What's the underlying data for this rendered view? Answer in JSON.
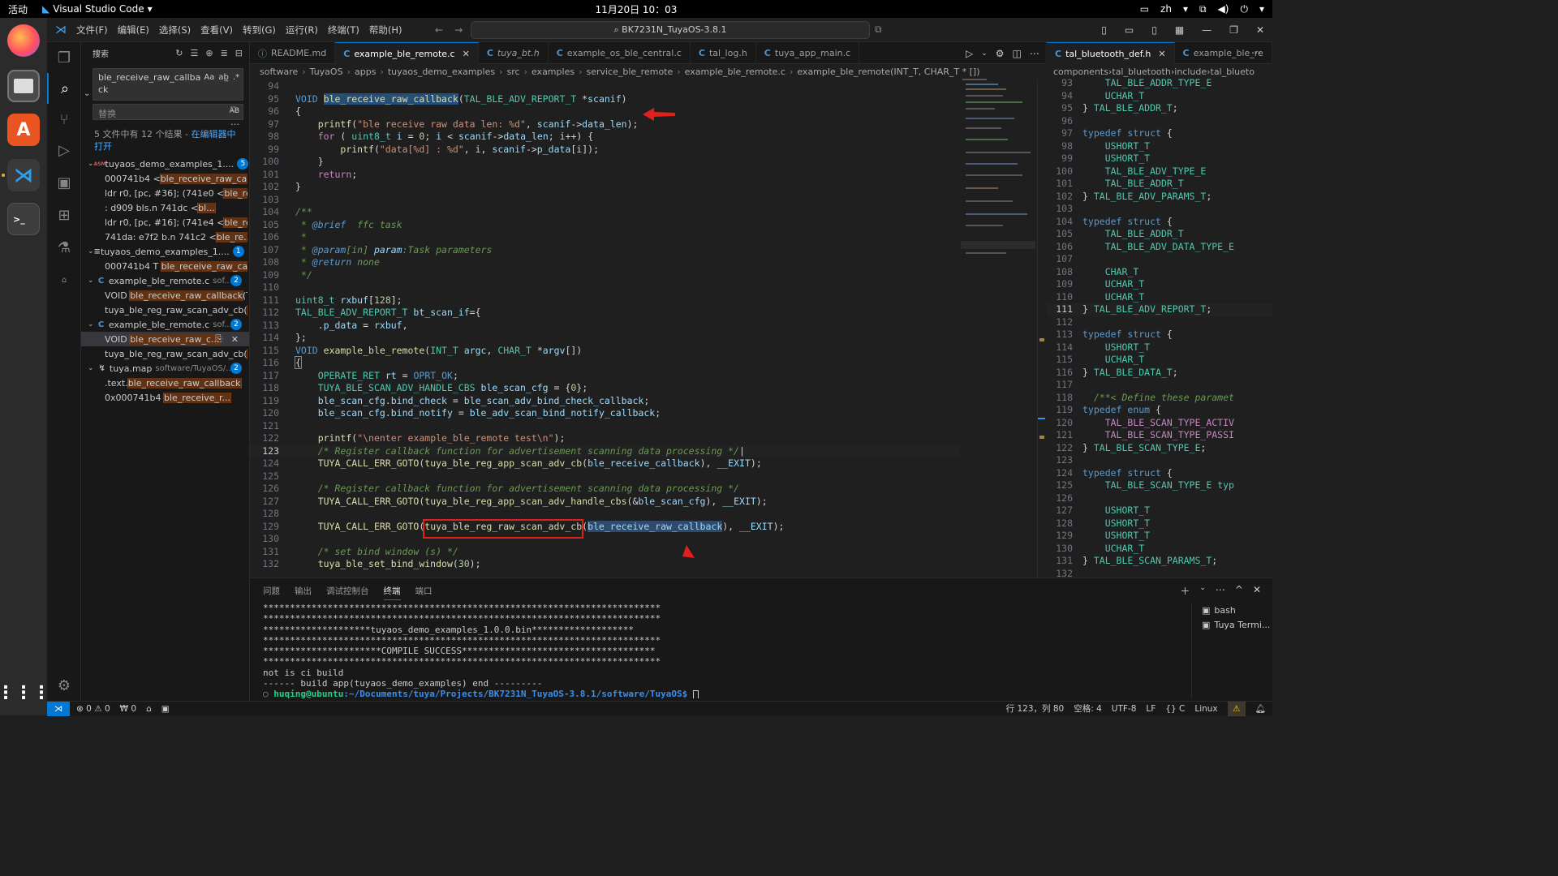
{
  "topbar": {
    "activities": "活动",
    "app_name": "Visual Studio Code",
    "clock": "11月20日  10：03",
    "lang": "zh"
  },
  "title": {
    "menu": [
      "文件(F)",
      "编辑(E)",
      "选择(S)",
      "查看(V)",
      "转到(G)",
      "运行(R)",
      "终端(T)",
      "帮助(H)"
    ],
    "command_center": "BK7231N_TuyaOS-3.8.1"
  },
  "sidebar": {
    "header": "搜索",
    "search_value": "ble_receive_raw_callback",
    "replace_placeholder": "替换",
    "replace_toggle": "AB",
    "summary_prefix": "5 文件中有 12 个结果 - ",
    "summary_link": "在编辑器中打开",
    "groups": [
      {
        "name": "tuyaos_demo_examples_1....",
        "path": "",
        "icon": "ASM",
        "count": "5",
        "matches": [
          {
            "before": "000741b4 <",
            "hit": "ble_receive_raw_callb...",
            "after": ""
          },
          {
            "before": "ldr  r0, [pc, #36]; (741e0 <",
            "hit": "ble_rece...",
            "after": ""
          },
          {
            "before": ":     d909          bls.n      741dc <",
            "hit": "bl...",
            "after": ""
          },
          {
            "before": "ldr  r0, [pc, #16]; (741e4 <",
            "hit": "ble_rece...",
            "after": ""
          },
          {
            "before": "741da:  e7f2        b.n 741c2 <",
            "hit": "ble_re...",
            "after": ""
          }
        ]
      },
      {
        "name": "tuyaos_demo_examples_1....",
        "path": "",
        "icon": "≡",
        "count": "1",
        "matches": [
          {
            "before": "000741b4 T ",
            "hit": "ble_receive_raw_callb...",
            "after": ""
          }
        ]
      },
      {
        "name": "example_ble_remote.c",
        "path": "sof...",
        "icon": "C",
        "count": "2",
        "matches": [
          {
            "before": "VOID ",
            "hit": "ble_receive_raw_callback",
            "after": "(TA..."
          },
          {
            "before": "tuya_ble_reg_raw_scan_adv_cb(",
            "hit": "bl...",
            "after": ""
          }
        ]
      },
      {
        "name": "example_ble_remote.c",
        "path": "sof...",
        "icon": "C",
        "count": "2",
        "matches": [
          {
            "before": "VOID ",
            "hit": "ble_receive_raw_c...",
            "after": "",
            "selected": true
          },
          {
            "before": "tuya_ble_reg_raw_scan_adv_cb(",
            "hit": "bl...",
            "after": ""
          }
        ]
      },
      {
        "name": "tuya.map",
        "path": "software/TuyaOS/...",
        "icon": "↯",
        "count": "2",
        "matches": [
          {
            "before": ".text.",
            "hit": "ble_receive_raw_callback",
            "after": ""
          },
          {
            "before": "0x000741b4              ",
            "hit": "ble_receive_r...",
            "after": ""
          }
        ]
      }
    ]
  },
  "editor": {
    "tabs": [
      {
        "label": "README.md",
        "icon": "ⓘ",
        "active": false,
        "italic": false
      },
      {
        "label": "example_ble_remote.c",
        "icon": "C",
        "active": true,
        "italic": false
      },
      {
        "label": "tuya_bt.h",
        "icon": "C",
        "active": false,
        "italic": true
      },
      {
        "label": "example_os_ble_central.c",
        "icon": "C",
        "active": false,
        "italic": false
      },
      {
        "label": "tal_log.h",
        "icon": "C",
        "active": false,
        "italic": false
      },
      {
        "label": "tuya_app_main.c",
        "icon": "C",
        "active": false,
        "italic": false
      }
    ],
    "breadcrumb": [
      "software",
      "TuyaOS",
      "apps",
      "tuyaos_demo_examples",
      "src",
      "examples",
      "service_ble_remote",
      "example_ble_remote.c",
      "example_ble_remote(INT_T, CHAR_T * [])"
    ],
    "current_line": "123",
    "lines": [
      {
        "n": "94",
        "html": ""
      },
      {
        "n": "95",
        "html": "<span class='k'>VOID</span> <span class='f hl'>ble_receive_raw_callback</span><span class='p'>(</span><span class='t'>TAL_BLE_ADV_REPORT_T</span> <span class='p'>*</span><span class='v'>scanif</span><span class='p'>)</span>"
      },
      {
        "n": "96",
        "html": "<span class='p'>{</span>"
      },
      {
        "n": "97",
        "html": "    <span class='f'>printf</span><span class='p'>(</span><span class='s'>\"ble receive raw data len: %d\"</span><span class='p'>, </span><span class='v'>scanif</span><span class='p'>-&gt;</span><span class='v'>data_len</span><span class='p'>);</span>"
      },
      {
        "n": "98",
        "html": "    <span class='m'>for</span> <span class='p'>( </span><span class='t'>uint8_t</span> <span class='v'>i</span> <span class='p'>= </span><span class='n'>0</span><span class='p'>; </span><span class='v'>i</span> <span class='p'>&lt; </span><span class='v'>scanif</span><span class='p'>-&gt;</span><span class='v'>data_len</span><span class='p'>; </span><span class='v'>i</span><span class='p'>++) {</span>"
      },
      {
        "n": "99",
        "html": "        <span class='f'>printf</span><span class='p'>(</span><span class='s'>\"data[%d] : %d\"</span><span class='p'>, </span><span class='v'>i</span><span class='p'>, </span><span class='v'>scanif</span><span class='p'>-&gt;</span><span class='v'>p_data</span><span class='p'>[</span><span class='v'>i</span><span class='p'>]);</span>"
      },
      {
        "n": "100",
        "html": "    <span class='p'>}</span>"
      },
      {
        "n": "101",
        "html": "    <span class='m'>return</span><span class='p'>;</span>"
      },
      {
        "n": "102",
        "html": "<span class='p'>}</span>"
      },
      {
        "n": "103",
        "html": ""
      },
      {
        "n": "104",
        "html": "<span class='cm'>/**</span>"
      },
      {
        "n": "105",
        "html": "<span class='cm'> * </span><span class='k' style='font-style:italic'>@brief</span><span class='cm'>  ffc task</span>"
      },
      {
        "n": "106",
        "html": "<span class='cm'> *</span>"
      },
      {
        "n": "107",
        "html": "<span class='cm'> * </span><span class='k' style='font-style:italic'>@param</span><span class='cm'>[in] </span><span class='v' style='font-style:italic'>param</span><span class='cm'>:Task parameters</span>"
      },
      {
        "n": "108",
        "html": "<span class='cm'> * </span><span class='k' style='font-style:italic'>@return</span><span class='cm'> none</span>"
      },
      {
        "n": "109",
        "html": "<span class='cm'> */</span>"
      },
      {
        "n": "110",
        "html": ""
      },
      {
        "n": "111",
        "html": "<span class='t'>uint8_t</span> <span class='v'>rxbuf</span><span class='p'>[</span><span class='n'>128</span><span class='p'>];</span>"
      },
      {
        "n": "112",
        "html": "<span class='t'>TAL_BLE_ADV_REPORT_T</span> <span class='v'>bt_scan_if</span><span class='p'>={</span>"
      },
      {
        "n": "113",
        "html": "    <span class='p'>.</span><span class='v'>p_data</span> <span class='p'>= </span><span class='v'>rxbuf</span><span class='p'>,</span>"
      },
      {
        "n": "114",
        "html": "<span class='p'>};</span>"
      },
      {
        "n": "115",
        "html": "<span class='k'>VOID</span> <span class='f'>example_ble_remote</span><span class='p'>(</span><span class='t'>INT_T</span> <span class='v'>argc</span><span class='p'>, </span><span class='t'>CHAR_T</span> <span class='p'>*</span><span class='v'>argv</span><span class='p'>[])</span>"
      },
      {
        "n": "116",
        "html": "<span class='p' style='outline:1px solid #888'>{</span>"
      },
      {
        "n": "117",
        "html": "    <span class='t'>OPERATE_RET</span> <span class='v'>rt</span> <span class='p'>= </span><span class='k'>OPRT_OK</span><span class='p'>;</span>"
      },
      {
        "n": "118",
        "html": "    <span class='t'>TUYA_BLE_SCAN_ADV_HANDLE_CBS</span> <span class='v'>ble_scan_cfg</span> <span class='p'>= {</span><span class='n'>0</span><span class='p'>};</span>"
      },
      {
        "n": "119",
        "html": "    <span class='v'>ble_scan_cfg</span><span class='p'>.</span><span class='v'>bind_check</span> <span class='p'>= </span><span class='v'>ble_scan_adv_bind_check_callback</span><span class='p'>;</span>"
      },
      {
        "n": "120",
        "html": "    <span class='v'>ble_scan_cfg</span><span class='p'>.</span><span class='v'>bind_notify</span> <span class='p'>= </span><span class='v'>ble_adv_scan_bind_notify_callback</span><span class='p'>;</span>"
      },
      {
        "n": "121",
        "html": ""
      },
      {
        "n": "122",
        "html": "    <span class='f'>printf</span><span class='p'>(</span><span class='s'>\"\\nenter example_ble_remote test\\n\"</span><span class='p'>);</span>"
      },
      {
        "n": "123",
        "html": "    <span class='cm'>/* Register callback function for advertisement scanning data processing */</span><span class='p'>|</span>"
      },
      {
        "n": "124",
        "html": "    <span class='f'>TUYA_CALL_ERR_GOTO</span><span class='p'>(</span><span class='f'>tuya_ble_reg_app_scan_adv_cb</span><span class='p'>(</span><span class='v'>ble_receive_callback</span><span class='p'>), </span><span class='v'>__EXIT</span><span class='p'>);</span>"
      },
      {
        "n": "125",
        "html": ""
      },
      {
        "n": "126",
        "html": "    <span class='cm'>/* Register callback function for advertisement scanning data processing */</span>"
      },
      {
        "n": "127",
        "html": "    <span class='f'>TUYA_CALL_ERR_GOTO</span><span class='p'>(</span><span class='f'>tuya_ble_reg_app_scan_adv_handle_cbs</span><span class='p'>(&amp;</span><span class='v'>ble_scan_cfg</span><span class='p'>), </span><span class='v'>__EXIT</span><span class='p'>);</span>"
      },
      {
        "n": "128",
        "html": ""
      },
      {
        "n": "129",
        "html": "    <span class='f'>TUYA_CALL_ERR_GOTO</span><span class='p'>(</span><span class='f'>tuya_ble_reg_raw_scan_adv_cb</span><span class='p'>(</span><span class='v hl2'>ble_receive_raw_callback</span><span class='p'>), </span><span class='v'>__EXIT</span><span class='p'>);</span>"
      },
      {
        "n": "130",
        "html": ""
      },
      {
        "n": "131",
        "html": "    <span class='cm'>/* set bind window (s) */</span>"
      },
      {
        "n": "132",
        "html": "    <span class='f'>tuya_ble_set_bind_window</span><span class='p'>(</span><span class='n'>30</span><span class='p'>);</span>"
      }
    ]
  },
  "split": {
    "tabs": [
      {
        "label": "tal_bluetooth_def.h",
        "icon": "C",
        "active": true
      },
      {
        "label": "example_ble_re",
        "icon": "C",
        "active": false
      }
    ],
    "breadcrumb": [
      "components",
      "tal_bluetooth",
      "include",
      "tal_blueto"
    ],
    "current_line": "111",
    "lines": [
      {
        "n": "93",
        "html": "    <span class='t'>TAL_BLE_ADDR_TYPE_E</span>"
      },
      {
        "n": "94",
        "html": "    <span class='t'>UCHAR_T</span>"
      },
      {
        "n": "95",
        "html": "<span class='p'>} </span><span class='t'>TAL_BLE_ADDR_T</span><span class='p'>;</span>"
      },
      {
        "n": "96",
        "html": ""
      },
      {
        "n": "97",
        "html": "<span class='k'>typedef</span> <span class='k'>struct</span> <span class='p'>{</span>"
      },
      {
        "n": "98",
        "html": "    <span class='t'>USHORT_T</span>"
      },
      {
        "n": "99",
        "html": "    <span class='t'>USHORT_T</span>"
      },
      {
        "n": "100",
        "html": "    <span class='t'>TAL_BLE_ADV_TYPE_E</span>"
      },
      {
        "n": "101",
        "html": "    <span class='t'>TAL_BLE_ADDR_T</span>"
      },
      {
        "n": "102",
        "html": "<span class='p'>} </span><span class='t'>TAL_BLE_ADV_PARAMS_T</span><span class='p'>;</span>"
      },
      {
        "n": "103",
        "html": ""
      },
      {
        "n": "104",
        "html": "<span class='k'>typedef</span> <span class='k'>struct</span> <span class='p'>{</span>"
      },
      {
        "n": "105",
        "html": "    <span class='t'>TAL_BLE_ADDR_T</span>"
      },
      {
        "n": "106",
        "html": "    <span class='t'>TAL_BLE_ADV_DATA_TYPE_E</span>"
      },
      {
        "n": "107",
        "html": ""
      },
      {
        "n": "108",
        "html": "    <span class='t'>CHAR_T</span>"
      },
      {
        "n": "109",
        "html": "    <span class='t'>UCHAR_T</span>"
      },
      {
        "n": "110",
        "html": "    <span class='t'>UCHAR_T</span>"
      },
      {
        "n": "111",
        "html": "<span class='p'>} </span><span class='t'>TAL_BLE_ADV_REPORT_T</span><span class='p'>;</span>"
      },
      {
        "n": "112",
        "html": ""
      },
      {
        "n": "113",
        "html": "<span class='k'>typedef</span> <span class='k'>struct</span> <span class='p'>{</span>"
      },
      {
        "n": "114",
        "html": "    <span class='t'>USHORT_T</span>"
      },
      {
        "n": "115",
        "html": "    <span class='t'>UCHAR_T</span>"
      },
      {
        "n": "116",
        "html": "<span class='p'>} </span><span class='t'>TAL_BLE_DATA_T</span><span class='p'>;</span>"
      },
      {
        "n": "117",
        "html": ""
      },
      {
        "n": "118",
        "html": "  <span class='cm'>/**&lt; Define these paramet</span>"
      },
      {
        "n": "119",
        "html": "<span class='k'>typedef</span> <span class='k'>enum</span> <span class='p'>{</span>"
      },
      {
        "n": "120",
        "html": "    <span class='m'>TAL_BLE_SCAN_TYPE_ACTIV</span>"
      },
      {
        "n": "121",
        "html": "    <span class='m'>TAL_BLE_SCAN_TYPE_PASSI</span>"
      },
      {
        "n": "122",
        "html": "<span class='p'>} </span><span class='t'>TAL_BLE_SCAN_TYPE_E</span><span class='p'>;</span>"
      },
      {
        "n": "123",
        "html": ""
      },
      {
        "n": "124",
        "html": "<span class='k'>typedef</span> <span class='k'>struct</span> <span class='p'>{</span>"
      },
      {
        "n": "125",
        "html": "    <span class='t'>TAL_BLE_SCAN_TYPE_E</span> <span class='t'>typ</span>"
      },
      {
        "n": "126",
        "html": ""
      },
      {
        "n": "127",
        "html": "    <span class='t'>USHORT_T</span>"
      },
      {
        "n": "128",
        "html": "    <span class='t'>USHORT_T</span>"
      },
      {
        "n": "129",
        "html": "    <span class='t'>USHORT_T</span>"
      },
      {
        "n": "130",
        "html": "    <span class='t'>UCHAR_T</span>"
      },
      {
        "n": "131",
        "html": "<span class='p'>} </span><span class='t'>TAL_BLE_SCAN_PARAMS_T</span><span class='p'>;</span>"
      },
      {
        "n": "132",
        "html": ""
      }
    ]
  },
  "panel": {
    "tabs": [
      "问题",
      "输出",
      "调试控制台",
      "终端",
      "端口"
    ],
    "active_tab": "终端",
    "terminal_lines": [
      "**************************************************************************",
      "**************************************************************************",
      "********************tuyaos_demo_examples_1.0.0.bin*******************",
      "**************************************************************************",
      "**********************COMPILE SUCCESS************************************",
      "**************************************************************************",
      "not is ci build",
      "------ build app(tuyaos_demo_examples) end ---------"
    ],
    "prompt_user": "huqing@ubuntu",
    "prompt_path": ":~/Documents/tuya/Projects/BK7231N_TuyaOS-3.8.1/software/TuyaOS$",
    "terminals": [
      "bash",
      "Tuya Termi..."
    ]
  },
  "statusbar": {
    "errors": "0",
    "warnings": "0",
    "ports": "0",
    "position": "行 123，列 80",
    "spaces": "空格: 4",
    "encoding": "UTF-8",
    "eol": "LF",
    "language": "C",
    "platform": "Linux"
  },
  "colors": {
    "accent": "#0078d4",
    "annotation": "#e0201b"
  }
}
